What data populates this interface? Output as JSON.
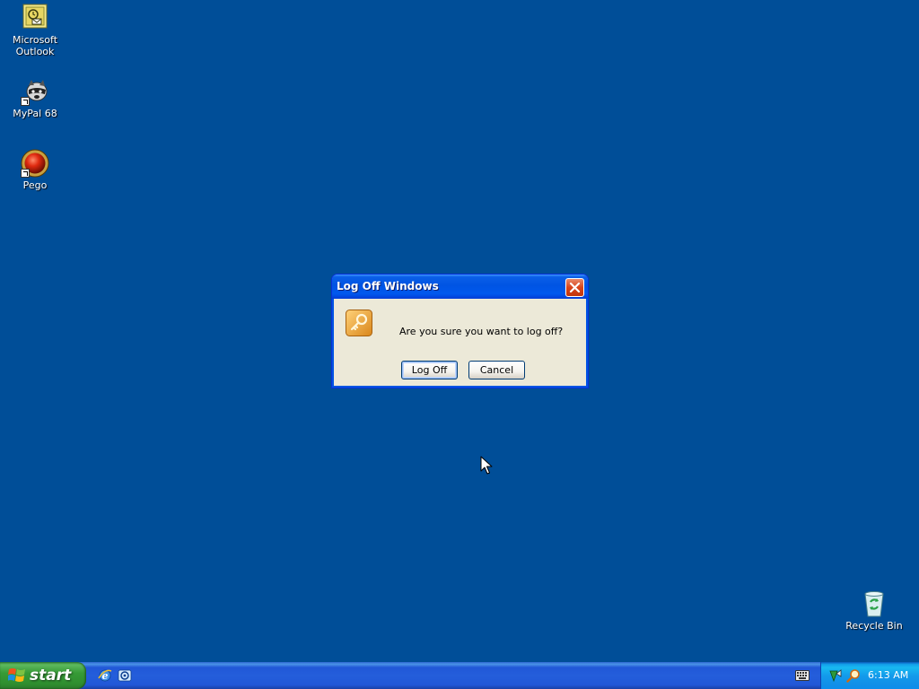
{
  "desktop": {
    "icons": [
      {
        "label": "Microsoft Outlook",
        "icon": "outlook-icon"
      },
      {
        "label": "MyPal 68",
        "icon": "raccoon-icon"
      },
      {
        "label": "Pego",
        "icon": "red-ball-icon"
      },
      {
        "label": "Recycle Bin",
        "icon": "recycle-bin-icon"
      }
    ],
    "background_color": "#004e98"
  },
  "dialog": {
    "title": "Log Off Windows",
    "message": "Are you sure you want to log off?",
    "logoff_label": "Log Off",
    "cancel_label": "Cancel",
    "icon": "key-icon"
  },
  "taskbar": {
    "start_label": "start",
    "quick_launch": [
      "internet-explorer-icon",
      "outlook-express-icon"
    ],
    "clock": "6:13 AM",
    "tray_icons": [
      "network-icon",
      "search-icon"
    ]
  }
}
